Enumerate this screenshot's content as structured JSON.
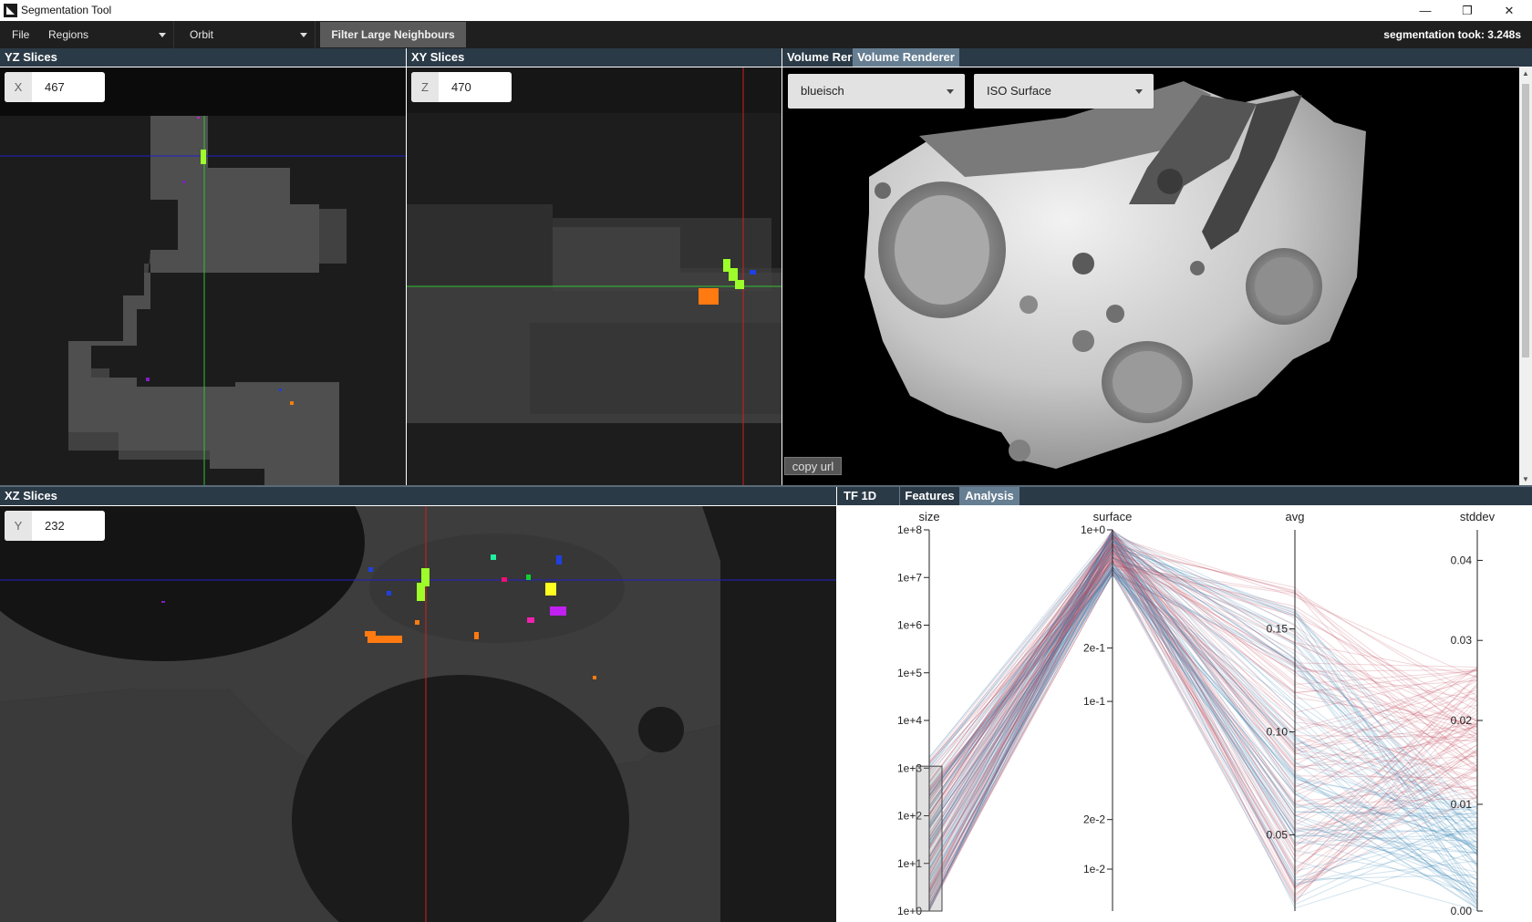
{
  "window": {
    "title": "Segmentation Tool",
    "controls": {
      "minimize": "—",
      "restore": "❐",
      "close": "✕"
    }
  },
  "menubar": {
    "file": "File",
    "regions": "Regions",
    "orbit": "Orbit",
    "filter_button": "Filter Large Neighbours",
    "segmentation_time": "segmentation took: 3.248s"
  },
  "yz_panel": {
    "title": "YZ Slices",
    "axis_label": "X",
    "value": "467"
  },
  "xy_panel": {
    "title": "XY Slices",
    "axis_label": "Z",
    "value": "470"
  },
  "xz_panel": {
    "title": "XZ Slices",
    "axis_label": "Y",
    "value": "232"
  },
  "volume_panel": {
    "title": "Volume Rer",
    "tab_label": "Volume Renderer",
    "colormap": "blueisch",
    "render_mode": "ISO Surface",
    "copy_url": "copy url"
  },
  "bottom_tabs": {
    "tf1d": "TF 1D",
    "features": "Features",
    "analysis": "Analysis",
    "active": "Analysis"
  },
  "chart_data": {
    "type": "parallel-coordinates",
    "axes": [
      {
        "name": "size",
        "scale": "log",
        "ticks": [
          "1e+8",
          "1e+7",
          "1e+6",
          "1e+5",
          "1e+4",
          "1e+3",
          "1e+2",
          "1e+1",
          "1e+0"
        ],
        "tick_side": "left",
        "brush": [
          0,
          2600
        ]
      },
      {
        "name": "surface",
        "scale": "log",
        "ticks": [
          "1e+0",
          "2e-1",
          "1e-1",
          "2e-2",
          "1e-2"
        ],
        "tick_side": "left"
      },
      {
        "name": "avg",
        "scale": "linear",
        "ticks": [
          "0.15",
          "0.10",
          "0.05"
        ],
        "tick_side": "left"
      },
      {
        "name": "stddev",
        "scale": "linear",
        "ticks": [
          "0.04",
          "0.03",
          "0.02",
          "0.01",
          "0.00"
        ],
        "tick_side": "right"
      }
    ],
    "colors": {
      "high": "#c0485a",
      "low": "#2e7fb0"
    }
  }
}
